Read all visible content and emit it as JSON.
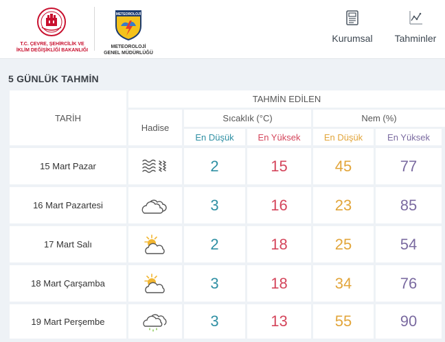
{
  "header": {
    "ministry_caption_1": "T.C. ÇEVRE, ŞEHİRCİLİK VE",
    "ministry_caption_2": "İKLİM DEĞİŞİKLİĞİ BAKANLIĞI",
    "mgm_badge": "METEOROLOJİ",
    "mgm_caption_1": "METEOROLOJİ",
    "mgm_caption_2": "GENEL MÜDÜRLÜĞÜ",
    "nav": [
      {
        "label": "Kurumsal",
        "icon": "document-icon"
      },
      {
        "label": "Tahminler",
        "icon": "chart-icon"
      }
    ]
  },
  "section_title": "5 GÜNLÜK TAHMİN",
  "table": {
    "col_date": "TARİH",
    "col_predicted": "TAHMİN EDİLEN",
    "col_event": "Hadise",
    "col_temp": "Sıcaklık (°C)",
    "col_humidity": "Nem (%)",
    "sub_low": "En Düşük",
    "sub_high": "En Yüksek",
    "rows": [
      {
        "date": "15 Mart Pazar",
        "icon": "fog-icon",
        "temp_low": "2",
        "temp_high": "15",
        "hum_low": "45",
        "hum_high": "77"
      },
      {
        "date": "16 Mart Pazartesi",
        "icon": "cloudy-icon",
        "temp_low": "3",
        "temp_high": "16",
        "hum_low": "23",
        "hum_high": "85"
      },
      {
        "date": "17 Mart Salı",
        "icon": "partly-cloudy-icon",
        "temp_low": "2",
        "temp_high": "18",
        "hum_low": "25",
        "hum_high": "54"
      },
      {
        "date": "18 Mart Çarşamba",
        "icon": "partly-cloudy-icon",
        "temp_low": "3",
        "temp_high": "18",
        "hum_low": "34",
        "hum_high": "76"
      },
      {
        "date": "19 Mart Perşembe",
        "icon": "rain-showers-icon",
        "temp_low": "3",
        "temp_high": "13",
        "hum_low": "55",
        "hum_high": "90"
      }
    ]
  },
  "colors": {
    "low_temp": "#2e8fa3",
    "high_temp": "#d4455b",
    "low_hum": "#e2a53a",
    "high_hum": "#7a6aa0",
    "brand_red": "#c8102e"
  }
}
